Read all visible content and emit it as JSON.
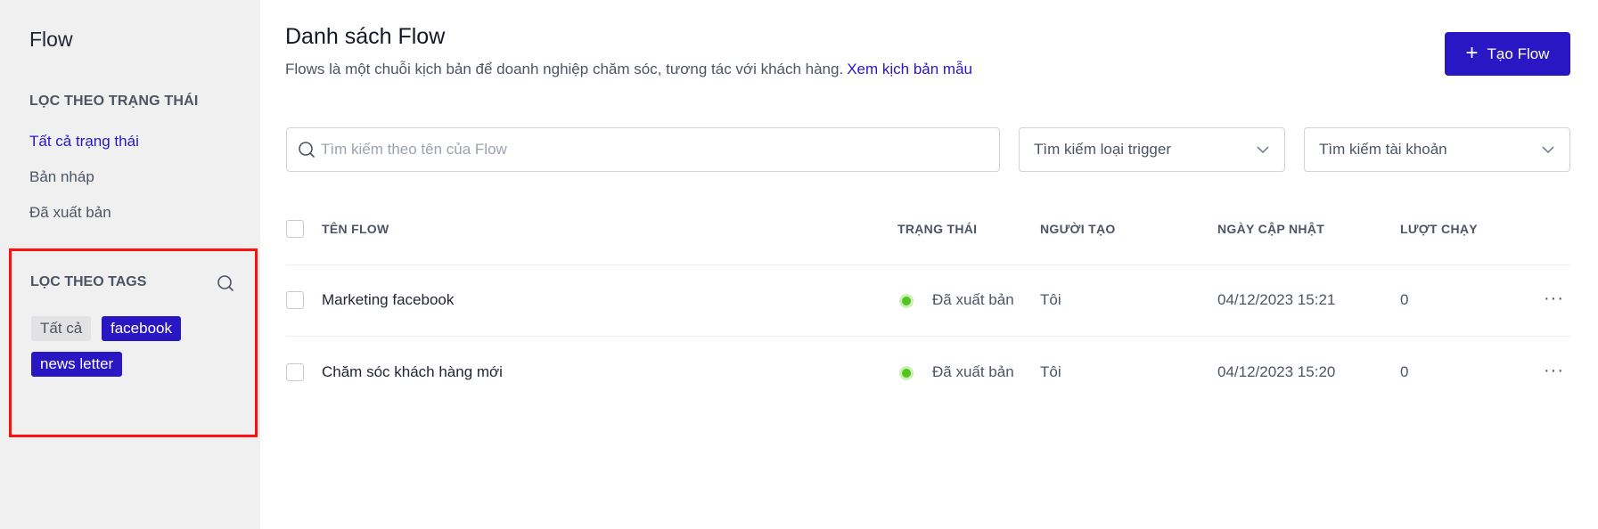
{
  "sidebar": {
    "title": "Flow",
    "status_filter": {
      "title": "LỌC THEO TRẠNG THÁI",
      "items": [
        "Tất cả trạng thái",
        "Bản nháp",
        "Đã xuất bản"
      ],
      "active": "Tất cả trạng thái"
    },
    "tag_filter": {
      "title": "LỌC THEO TAGS",
      "search_icon": "search-icon",
      "tags": [
        "Tất cả",
        "facebook",
        "news letter"
      ]
    }
  },
  "header": {
    "title": "Danh sách Flow",
    "description": "Flows là một chuỗi kịch bản để doanh nghiệp chăm sóc, tương tác với khách hàng.",
    "link": "Xem kịch bản mẫu",
    "create_button": "Tạo Flow",
    "create_icon": "plus-icon"
  },
  "filters": {
    "search_placeholder": "Tìm kiếm theo tên của Flow",
    "trigger_select": "Tìm kiếm loại trigger",
    "account_select": "Tìm kiếm tài khoản"
  },
  "table": {
    "columns": [
      "TÊN FLOW",
      "TRẠNG THÁI",
      "NGƯỜI TẠO",
      "NGÀY CẬP NHẬT",
      "LƯỢT CHẠY"
    ],
    "rows": [
      {
        "name": "Marketing facebook",
        "status": "Đã xuất bản",
        "creator": "Tôi",
        "updated": "04/12/2023 15:21",
        "runs": "0"
      },
      {
        "name": "Chăm sóc khách hàng mới",
        "status": "Đã xuất bản",
        "creator": "Tôi",
        "updated": "04/12/2023 15:20",
        "runs": "0"
      }
    ],
    "more_icon": "···"
  },
  "colors": {
    "accent": "#2a17c4",
    "status_published": "#52c41a",
    "highlight_border": "#ff1010"
  }
}
